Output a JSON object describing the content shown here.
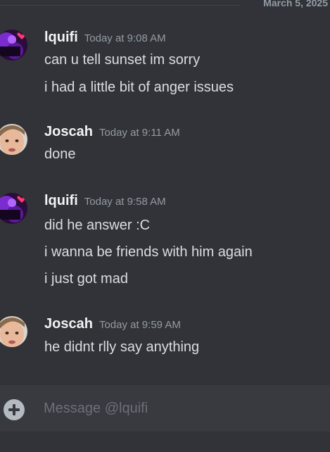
{
  "divider": {
    "date": "March 5, 2025"
  },
  "messages": [
    {
      "username": "lquifi",
      "timestamp": "Today at 9:08 AM",
      "avatar": "lquifi-purple-avatar",
      "lines": [
        "can u tell sunset im sorry",
        "i had a little bit of anger issues"
      ]
    },
    {
      "username": "Joscah",
      "timestamp": "Today at 9:11 AM",
      "avatar": "joscah-face-avatar",
      "lines": [
        "done"
      ]
    },
    {
      "username": "lquifi",
      "timestamp": "Today at 9:58 AM",
      "avatar": "lquifi-purple-avatar",
      "lines": [
        "did he answer :C",
        "i wanna be friends with him again",
        "i just got mad"
      ]
    },
    {
      "username": "Joscah",
      "timestamp": "Today at 9:59 AM",
      "avatar": "joscah-face-avatar",
      "lines": [
        "he didnt rlly say anything"
      ]
    }
  ],
  "composer": {
    "placeholder": "Message @lquifi",
    "value": "",
    "attach_icon": "plus-circle-icon"
  },
  "colors": {
    "background": "#313338",
    "composer": "#383a40",
    "username": "#f2f3f5",
    "message_text": "#dbdee1",
    "timestamp": "#949ba4",
    "accent_heart": "#ff3b6b"
  }
}
